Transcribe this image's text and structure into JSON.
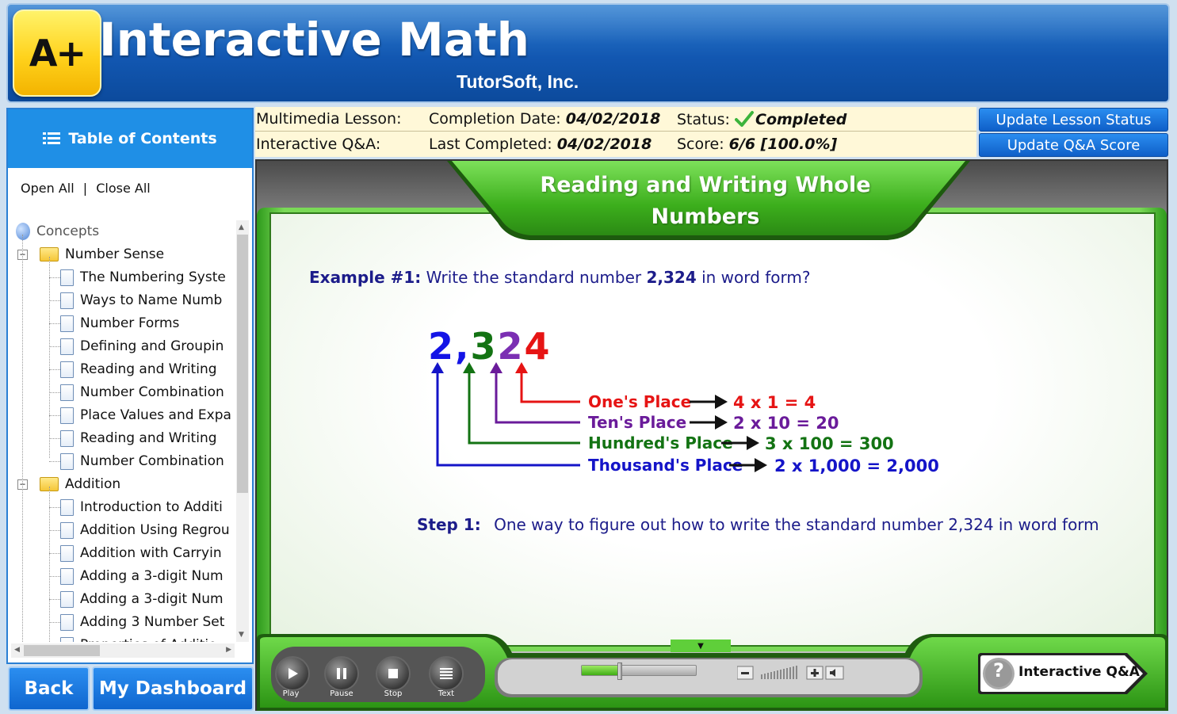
{
  "header": {
    "logo_text": "A+",
    "title": "Interactive Math",
    "company": "TutorSoft, Inc."
  },
  "sidebar": {
    "toc_title": "Table of Contents",
    "open_all": "Open All",
    "separator": "|",
    "close_all": "Close All",
    "tree": [
      {
        "label": "Concepts",
        "kind": "root"
      },
      {
        "label": "Number Sense",
        "kind": "folder"
      },
      {
        "label": "The Numbering Syste",
        "kind": "page"
      },
      {
        "label": "Ways to Name Numb",
        "kind": "page"
      },
      {
        "label": "Number Forms",
        "kind": "page"
      },
      {
        "label": "Defining and Groupin",
        "kind": "page"
      },
      {
        "label": "Reading and Writing ",
        "kind": "page"
      },
      {
        "label": "Number Combination",
        "kind": "page"
      },
      {
        "label": "Place Values and Expa",
        "kind": "page"
      },
      {
        "label": "Reading and Writing ",
        "kind": "page"
      },
      {
        "label": "Number Combination",
        "kind": "page"
      },
      {
        "label": "Addition",
        "kind": "folder"
      },
      {
        "label": "Introduction to Additi",
        "kind": "page"
      },
      {
        "label": "Addition Using Regrou",
        "kind": "page"
      },
      {
        "label": "Addition with Carryin",
        "kind": "page"
      },
      {
        "label": "Adding a 3-digit Num",
        "kind": "page"
      },
      {
        "label": "Adding a 3-digit Num",
        "kind": "page"
      },
      {
        "label": "Adding 3 Number Set",
        "kind": "page"
      },
      {
        "label": "Properties of Additio",
        "kind": "page"
      }
    ]
  },
  "nav": {
    "back": "Back",
    "dashboard": "My Dashboard"
  },
  "status": {
    "lesson_label": "Multimedia Lesson:",
    "completion_label": "Completion Date:",
    "completion_date": "04/02/2018",
    "status_label": "Status:",
    "status_value": "Completed",
    "qa_label": "Interactive Q&A:",
    "last_label": "Last Completed:",
    "last_date": "04/02/2018",
    "score_label": "Score:",
    "score_value": "6/6 [100.0%]",
    "update_lesson": "Update Lesson Status",
    "update_qa": "Update Q&A Score"
  },
  "lesson": {
    "title_line1": "Reading and Writing Whole",
    "title_line2": "Numbers",
    "example_label": "Example #1:",
    "example_text_a": "Write the standard number ",
    "example_number": "2,324",
    "example_text_b": " in word form?",
    "digits": [
      {
        "char": "2",
        "color": "#1414e6"
      },
      {
        "char": ",",
        "color": "#1414e6"
      },
      {
        "char": "3",
        "color": "#137313"
      },
      {
        "char": "2",
        "color": "#7b2fb3"
      },
      {
        "char": "4",
        "color": "#e61414"
      }
    ],
    "places": [
      {
        "name": "One's Place",
        "expr": "4 x 1 = 4",
        "color": "#e61414"
      },
      {
        "name": "Ten's Place",
        "expr": "2 x 10 = 20",
        "color": "#6a1b9a"
      },
      {
        "name": "Hundred's Place",
        "expr": "3 x 100 = 300",
        "color": "#137313"
      },
      {
        "name": "Thousand's Place",
        "expr": "2 x 1,000 = 2,000",
        "color": "#1414c8"
      }
    ],
    "step_label": "Step 1:",
    "step_text": "One way to figure out how to write the standard number 2,324 in word form"
  },
  "controls": {
    "play": "Play",
    "pause": "Pause",
    "stop": "Stop",
    "text": "Text",
    "progress_fraction": 0.33,
    "qa_button": "Interactive Q&A",
    "qa_icon": "?"
  },
  "colors": {
    "accent_blue": "#1f8fe6",
    "lesson_green": "#4cbf2a",
    "status_bg": "#fff8d8"
  }
}
